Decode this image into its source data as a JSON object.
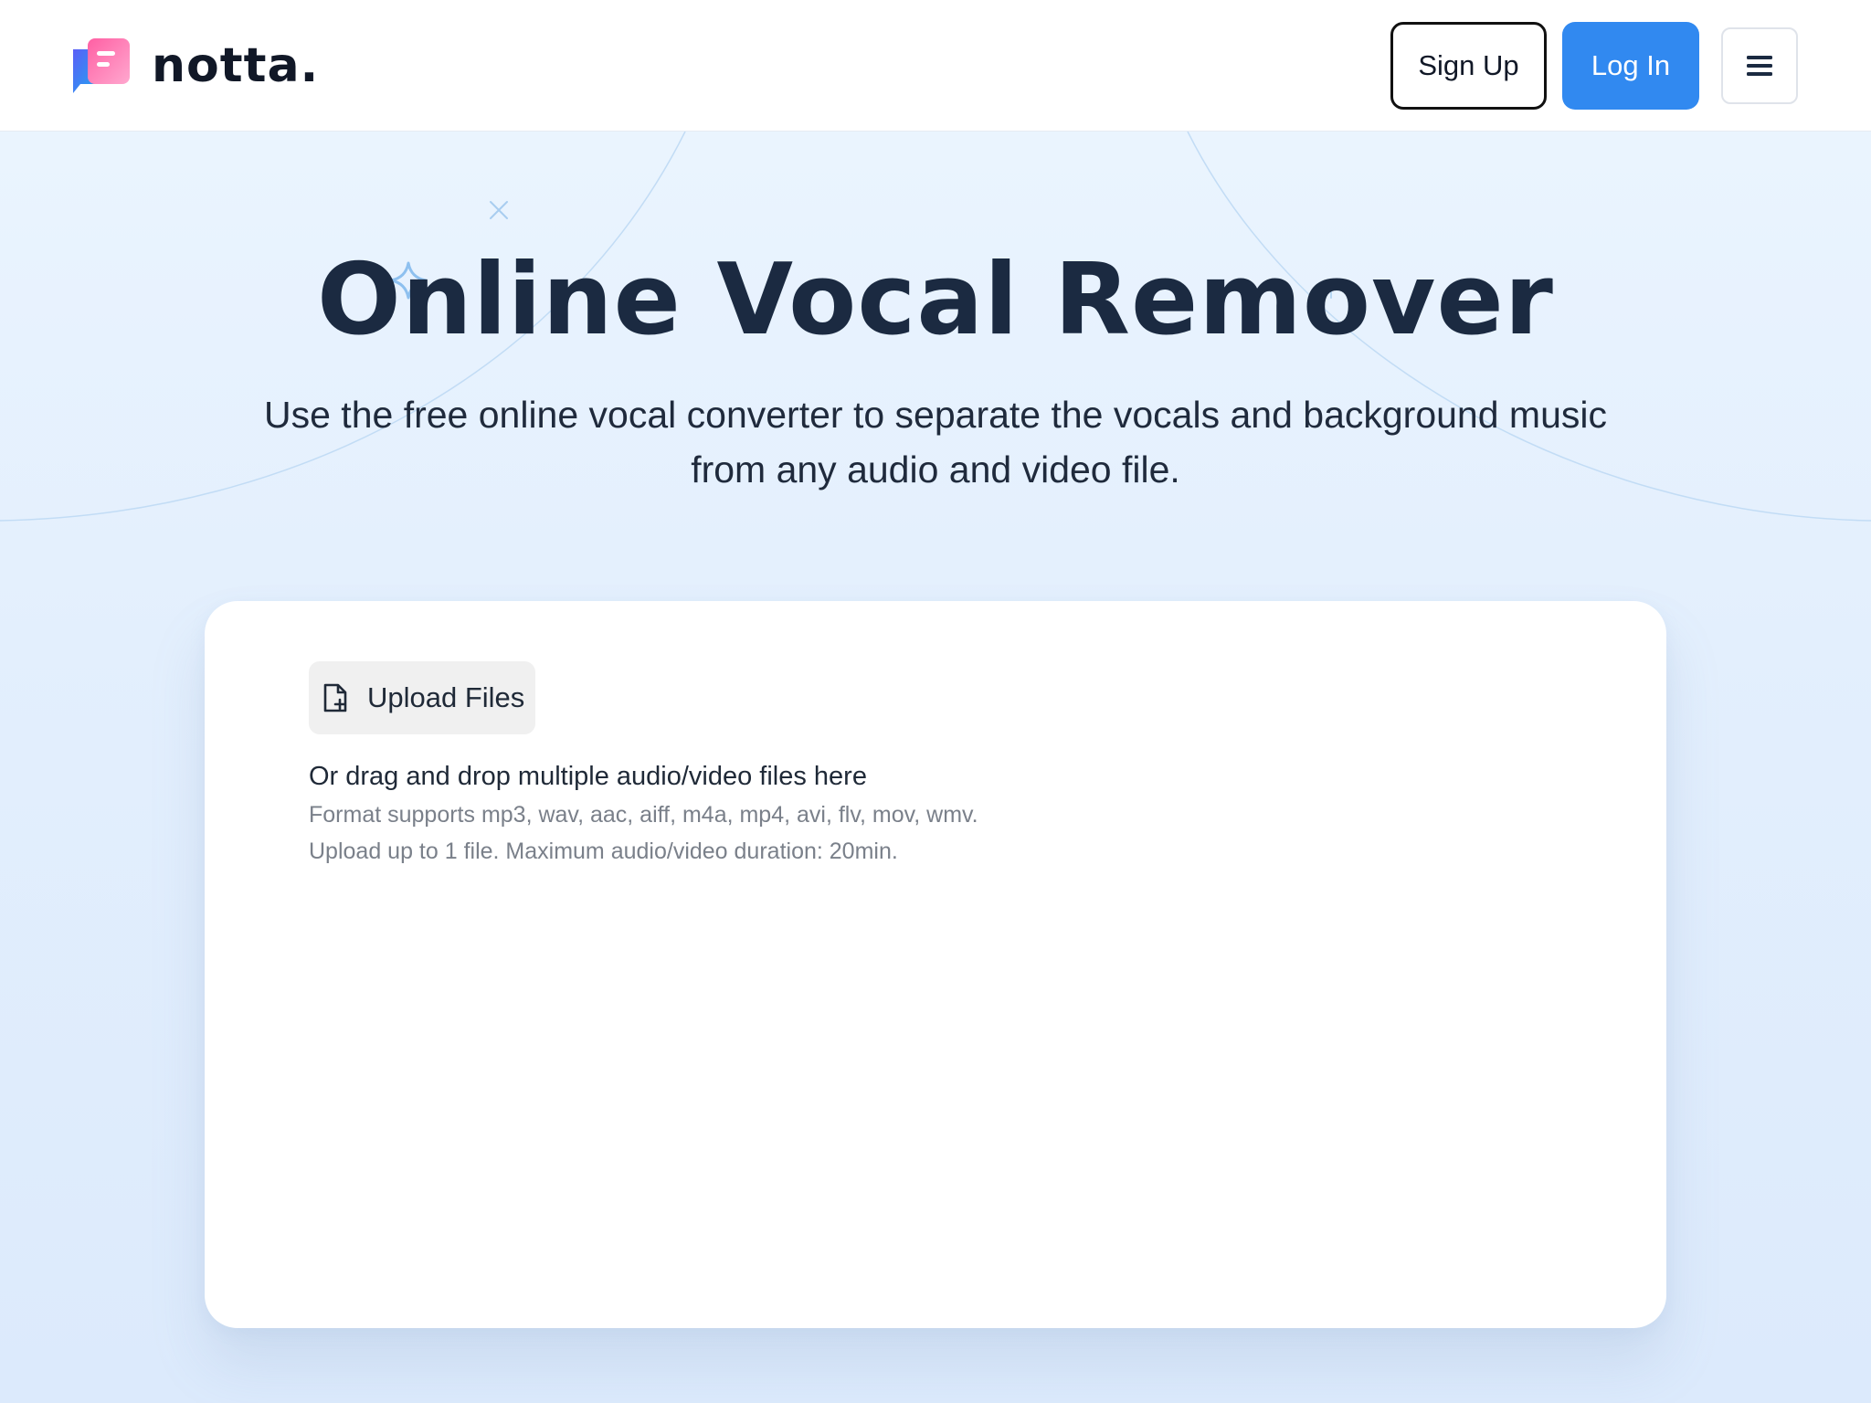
{
  "header": {
    "logo_text": "notta.",
    "signup_label": "Sign Up",
    "login_label": "Log In",
    "menu_icon": "hamburger-menu-icon"
  },
  "hero": {
    "title": "Online Vocal Remover",
    "subtitle": "Use the free online vocal converter to separate the vocals and background music from any audio and video file."
  },
  "upload": {
    "button_label": "Upload Files",
    "button_icon": "file-add-icon",
    "drop_text": "Or drag and drop multiple audio/video files here",
    "format_text": "Format supports mp3, wav, aac, aiff, m4a, mp4, avi, flv, mov, wmv.",
    "limit_text": "Upload up to 1 file. Maximum audio/video duration: 20min."
  },
  "colors": {
    "accent": "#3189f0",
    "title": "#1b2a41",
    "hero_bg": "#e3effd"
  }
}
